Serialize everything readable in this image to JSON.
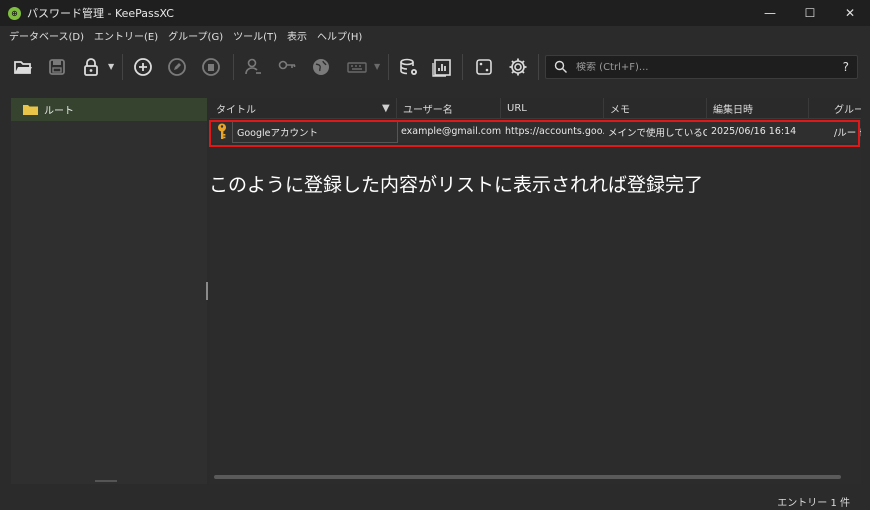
{
  "window": {
    "title": "パスワード管理 - KeePassXC",
    "app_icon_glyph": "⊕",
    "minimize_glyph": "—",
    "maximize_glyph": "☐",
    "close_glyph": "✕"
  },
  "menu": [
    "データベース(D)",
    "エントリー(E)",
    "グループ(G)",
    "ツール(T)",
    "表示",
    "ヘルプ(H)"
  ],
  "toolbar": {
    "icons": [
      "open-database-icon",
      "save-database-icon",
      "lock-database-icon",
      "add-entry-icon",
      "edit-entry-icon",
      "delete-entry-icon",
      "copy-username-icon",
      "copy-password-icon",
      "open-url-icon",
      "auto-type-icon",
      "database-settings-icon",
      "reports-icon",
      "password-generator-icon",
      "settings-icon"
    ]
  },
  "search": {
    "placeholder": "検索 (Ctrl+F)...",
    "help_glyph": "?"
  },
  "sidebar": {
    "items": [
      {
        "label": "ルート"
      }
    ]
  },
  "table": {
    "columns": [
      "タイトル",
      "ユーザー名",
      "URL",
      "メモ",
      "編集日時",
      "グループ"
    ],
    "sort_indicator": "▼",
    "rows": [
      {
        "title": "Googleアカウント",
        "username": "example@gmail.com",
        "url": "https://accounts.goo...",
        "notes": "メインで使用しているGo...",
        "modified": "2025/06/16 16:14",
        "group": "/ルート"
      }
    ]
  },
  "annotation": "このように登録した内容がリストに表示されれば登録完了",
  "status": {
    "entries_text": "エントリー 1 件"
  },
  "colors": {
    "highlight_border": "#e01818",
    "folder": "#e8c448",
    "key": "#e8a52a",
    "app_icon": "#7fbf3f"
  }
}
